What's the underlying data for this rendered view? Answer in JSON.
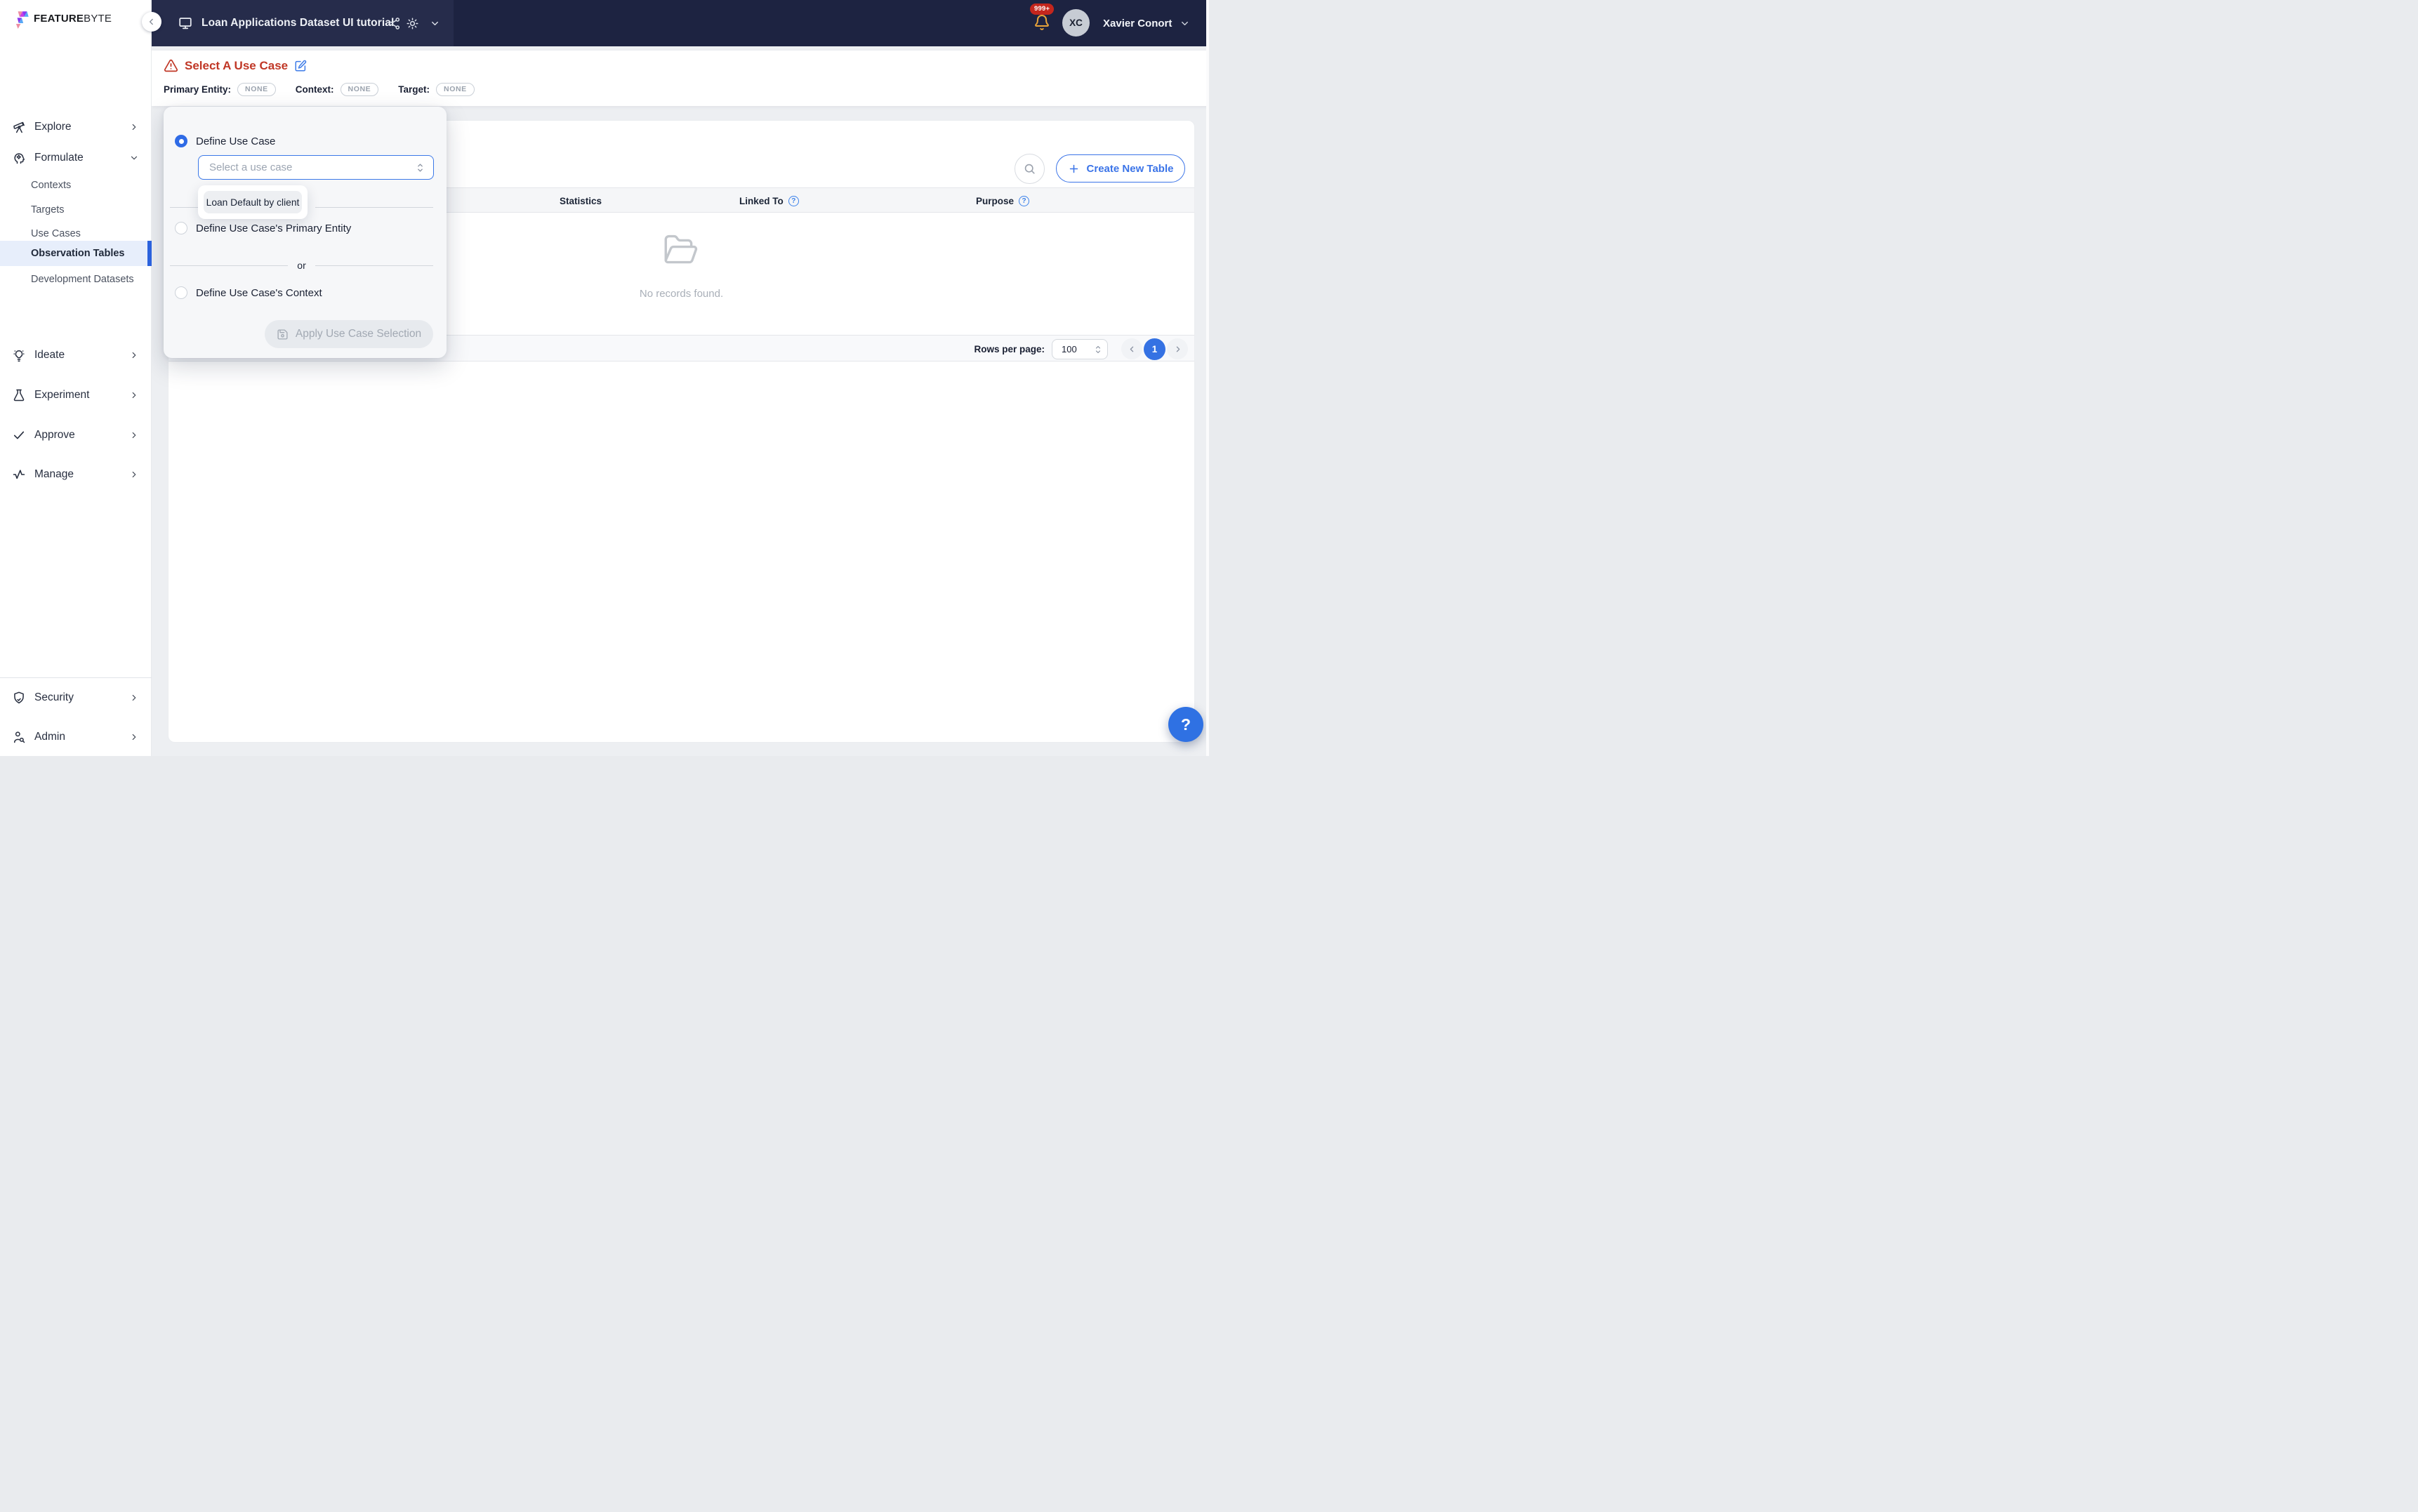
{
  "brand": {
    "logo_bold": "FEATURE",
    "logo_light": "BYTE"
  },
  "header": {
    "catalog_title": "Loan Applications Dataset UI tutorial",
    "notification_badge": "999+",
    "user_initials": "XC",
    "user_name": "Xavier Conort"
  },
  "sidebar": {
    "items": [
      {
        "label": "Explore"
      },
      {
        "label": "Formulate"
      },
      {
        "label": "Contexts"
      },
      {
        "label": "Targets"
      },
      {
        "label": "Use Cases"
      },
      {
        "label": "Observation Tables"
      },
      {
        "label": "Development Datasets"
      },
      {
        "label": "Ideate"
      },
      {
        "label": "Experiment"
      },
      {
        "label": "Approve"
      },
      {
        "label": "Manage"
      },
      {
        "label": "Security"
      },
      {
        "label": "Admin"
      }
    ]
  },
  "use_case_bar": {
    "title": "Select A Use Case",
    "fields": [
      {
        "label": "Primary Entity:",
        "value": "NONE"
      },
      {
        "label": "Context:",
        "value": "NONE"
      },
      {
        "label": "Target:",
        "value": "NONE"
      }
    ]
  },
  "popover": {
    "radio_define": "Define Use Case",
    "select_placeholder": "Select a use case",
    "dropdown_option": "Loan Default by client",
    "radio_primary_entity": "Define Use Case's Primary Entity",
    "divider": "or",
    "radio_context": "Define Use Case's Context",
    "apply_button": "Apply Use Case Selection"
  },
  "content": {
    "create_button": "Create New Table",
    "columns": [
      {
        "label": "Statistics"
      },
      {
        "label": "Linked To"
      },
      {
        "label": "Purpose"
      }
    ],
    "empty_message": "No records found.",
    "pagination": {
      "rows_per_page_label": "Rows per page:",
      "rows_per_page": "100",
      "current_page": "1"
    }
  },
  "colors": {
    "accent_blue": "#3b74e8",
    "alert_red": "#c03726",
    "header_navy": "#1d2341",
    "notification_red": "#c4261d",
    "bell_yellow": "#e7a33a",
    "selected_item_bg": "#e7eefb"
  }
}
